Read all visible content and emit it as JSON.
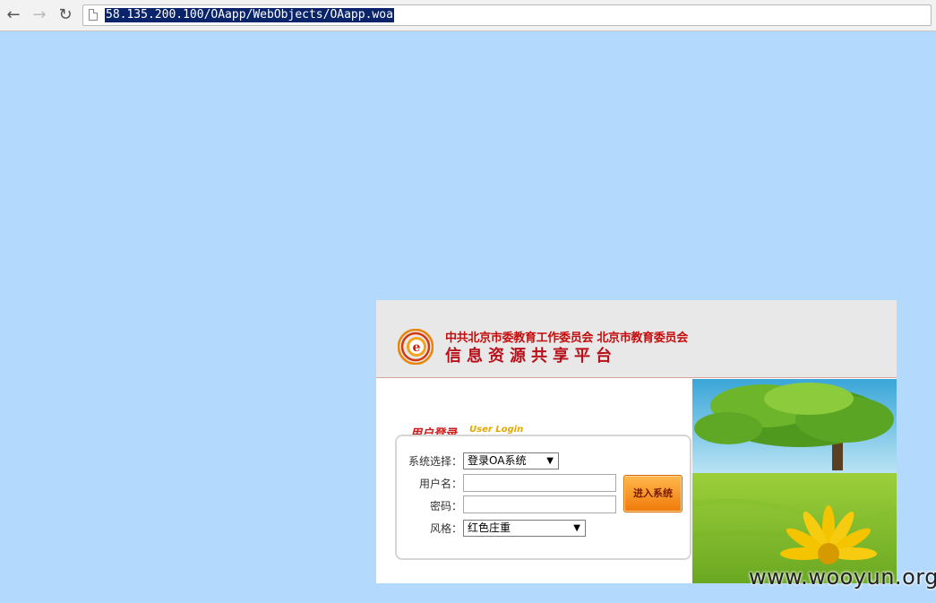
{
  "browser": {
    "back_icon": "←",
    "forward_icon": "→",
    "reload_icon": "↻",
    "url": "58.135.200.100/OAapp/WebObjects/OAapp.woa"
  },
  "header": {
    "line1": "中共北京市委教育工作委员会 北京市教育委员会",
    "line2": "信息资源共享平台"
  },
  "login": {
    "title": "用户登录",
    "subtitle": "User Login",
    "system_label": "系统选择：",
    "system_value": "登录OA系统",
    "username_label": "用户名：",
    "username_value": "",
    "password_label": "密码：",
    "password_value": "",
    "style_label": "风格：",
    "style_value": "红色庄重",
    "submit_label": "进入系统"
  },
  "colors": {
    "page_background": "#b3d9fc",
    "header_red": "#c40d0d",
    "button_orange": "#f07a0a"
  },
  "watermark": "www.wooyun.org"
}
